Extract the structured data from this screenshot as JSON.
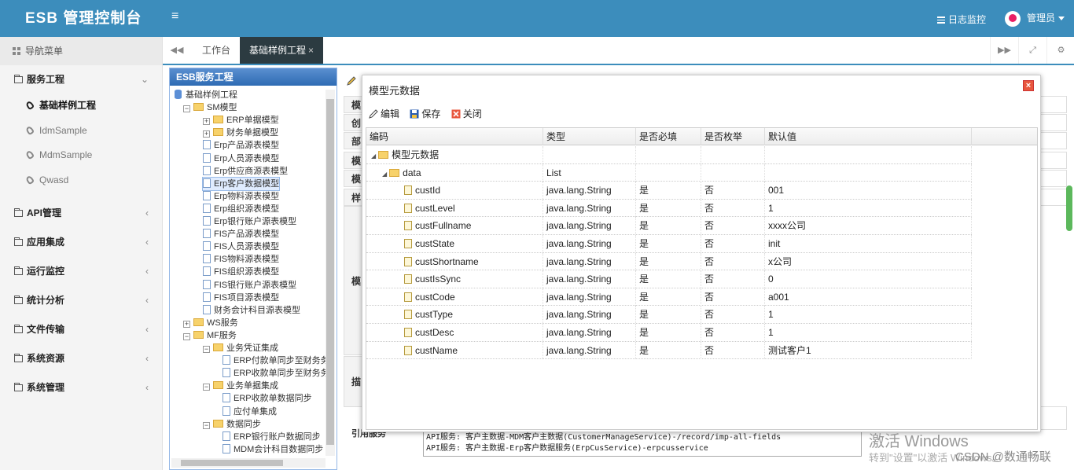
{
  "app": {
    "title": "ESB 管理控制台"
  },
  "topbar": {
    "menu_icon": "≡",
    "log_monitor": "日志监控",
    "user": "管理员"
  },
  "sidebar": {
    "header": "导航菜单",
    "groups": [
      {
        "label": "服务工程",
        "expanded": true,
        "children": [
          "基础样例工程",
          "IdmSample",
          "MdmSample",
          "Qwasd"
        ],
        "active_child": "基础样例工程"
      },
      {
        "label": "API管理"
      },
      {
        "label": "应用集成"
      },
      {
        "label": "运行监控"
      },
      {
        "label": "统计分析"
      },
      {
        "label": "文件传输"
      },
      {
        "label": "系统资源"
      },
      {
        "label": "系统管理"
      }
    ]
  },
  "tabs": {
    "items": [
      "工作台",
      "基础样例工程"
    ],
    "active": "基础样例工程",
    "close": "×"
  },
  "tree_panel": {
    "title": "ESB服务工程",
    "nodes": [
      {
        "label": "基础样例工程",
        "type": "root"
      },
      {
        "label": "SM模型",
        "type": "folder",
        "toggle": "−"
      },
      {
        "label": "ERP单据模型",
        "type": "folder",
        "toggle": "+"
      },
      {
        "label": "财务单据模型",
        "type": "folder",
        "toggle": "+"
      },
      {
        "label": "Erp产品源表模型",
        "type": "file"
      },
      {
        "label": "Erp人员源表模型",
        "type": "file"
      },
      {
        "label": "Erp供应商源表模型",
        "type": "file"
      },
      {
        "label": "Erp客户数据模型",
        "type": "file",
        "selected": true
      },
      {
        "label": "Erp物料源表模型",
        "type": "file"
      },
      {
        "label": "Erp组织源表模型",
        "type": "file"
      },
      {
        "label": "Erp银行账户源表模型",
        "type": "file"
      },
      {
        "label": "FIS产品源表模型",
        "type": "file"
      },
      {
        "label": "FIS人员源表模型",
        "type": "file"
      },
      {
        "label": "FIS物料源表模型",
        "type": "file"
      },
      {
        "label": "FIS组织源表模型",
        "type": "file"
      },
      {
        "label": "FIS银行账户源表模型",
        "type": "file"
      },
      {
        "label": "FIS项目源表模型",
        "type": "file"
      },
      {
        "label": "财务会计科目源表模型",
        "type": "file"
      },
      {
        "label": "WS服务",
        "type": "folder",
        "toggle": "+"
      },
      {
        "label": "MF服务",
        "type": "folder",
        "toggle": "−"
      },
      {
        "label": "业务凭证集成",
        "type": "folder",
        "toggle": "−"
      },
      {
        "label": "ERP付款单同步至财务务",
        "type": "file"
      },
      {
        "label": "ERP收款单同步至财务务",
        "type": "file"
      },
      {
        "label": "业务单据集成",
        "type": "folder",
        "toggle": "−"
      },
      {
        "label": "ERP收款单数据同步",
        "type": "file"
      },
      {
        "label": "应付单集成",
        "type": "file"
      },
      {
        "label": "数据同步",
        "type": "folder",
        "toggle": "−"
      },
      {
        "label": "ERP银行账户数据同步",
        "type": "file"
      },
      {
        "label": "MDM会计科目数据同步",
        "type": "file"
      }
    ]
  },
  "background_form": {
    "labels": [
      "模",
      "创",
      "部",
      "模",
      "模",
      "样",
      "模",
      "描",
      "引"
    ],
    "textarea_lines": [
      "API服务: 客户主数据-MDM客户主数据(CustomerManageService)-/record/imp-all-fields",
      "API服务: 客户主数据-Erp客户数据服务(ErpCusService)-erpcusservice"
    ],
    "cut_label": "引用服务"
  },
  "dialog": {
    "title": "模型元数据",
    "close": "×",
    "toolbar": {
      "edit": "编辑",
      "save": "保存",
      "close": "关闭"
    },
    "columns": [
      "编码",
      "类型",
      "是否必填",
      "是否枚举",
      "默认值"
    ],
    "rows": [
      {
        "code": "模型元数据",
        "type": "",
        "required": "",
        "enum": "",
        "default": "",
        "kind": "folder",
        "level": 0
      },
      {
        "code": "data",
        "type": "List",
        "required": "",
        "enum": "",
        "default": "",
        "kind": "folder",
        "level": 1
      },
      {
        "code": "custId",
        "type": "java.lang.String",
        "required": "是",
        "enum": "否",
        "default": "001",
        "kind": "file",
        "level": 2
      },
      {
        "code": "custLevel",
        "type": "java.lang.String",
        "required": "是",
        "enum": "否",
        "default": "1",
        "kind": "file",
        "level": 2
      },
      {
        "code": "custFullname",
        "type": "java.lang.String",
        "required": "是",
        "enum": "否",
        "default": "xxxx公司",
        "kind": "file",
        "level": 2
      },
      {
        "code": "custState",
        "type": "java.lang.String",
        "required": "是",
        "enum": "否",
        "default": "init",
        "kind": "file",
        "level": 2
      },
      {
        "code": "custShortname",
        "type": "java.lang.String",
        "required": "是",
        "enum": "否",
        "default": "x公司",
        "kind": "file",
        "level": 2
      },
      {
        "code": "custIsSync",
        "type": "java.lang.String",
        "required": "是",
        "enum": "否",
        "default": "0",
        "kind": "file",
        "level": 2
      },
      {
        "code": "custCode",
        "type": "java.lang.String",
        "required": "是",
        "enum": "否",
        "default": "a001",
        "kind": "file",
        "level": 2
      },
      {
        "code": "custType",
        "type": "java.lang.String",
        "required": "是",
        "enum": "否",
        "default": "1",
        "kind": "file",
        "level": 2
      },
      {
        "code": "custDesc",
        "type": "java.lang.String",
        "required": "是",
        "enum": "否",
        "default": "1",
        "kind": "file",
        "level": 2
      },
      {
        "code": "custName",
        "type": "java.lang.String",
        "required": "是",
        "enum": "否",
        "default": "测试客户1",
        "kind": "file",
        "level": 2
      }
    ]
  },
  "overlay": {
    "watermark": "激活 Windows",
    "watermark_sub": "转到\"设置\"以激活 Windows。",
    "credit": "CSDN @数通畅联"
  },
  "colors": {
    "header": "#3c8dbc",
    "active_tab": "#2c3b41",
    "panel_border": "#95b8e7",
    "folder": "#f7d26b"
  }
}
